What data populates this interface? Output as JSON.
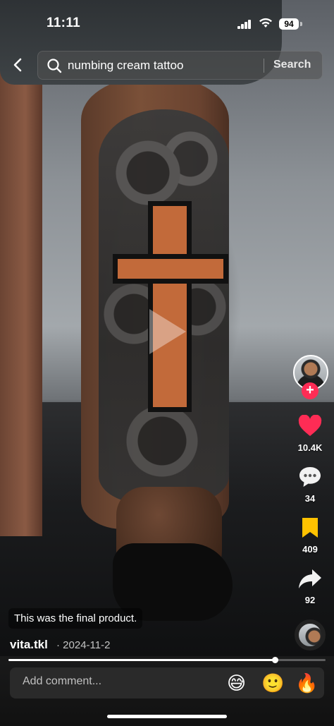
{
  "status_bar": {
    "time": "11:11",
    "battery": "94"
  },
  "search": {
    "query": "numbing cream tattoo",
    "button_label": "Search"
  },
  "rail": {
    "likes": "10.4K",
    "comments": "34",
    "saves": "409",
    "shares": "92"
  },
  "post": {
    "caption": "This was the final product.",
    "author": "vita.tkl",
    "date": "· 2024-11-2"
  },
  "playback": {
    "progress_fraction": 0.84
  },
  "comment_bar": {
    "placeholder": "Add comment...",
    "emojis": [
      "😅",
      "🙂",
      "🔥"
    ]
  },
  "colors": {
    "like": "#fe2c55",
    "save": "#ffc200",
    "follow": "#fe2c55"
  }
}
